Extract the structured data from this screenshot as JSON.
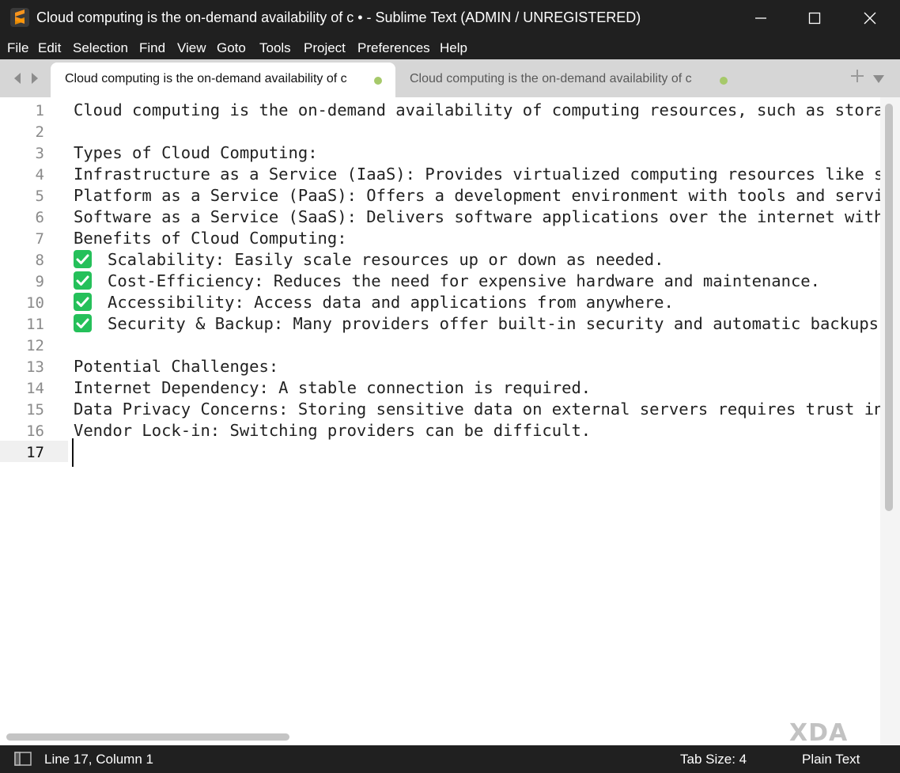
{
  "window": {
    "title": "Cloud computing is the on-demand availability of c • - Sublime Text (ADMIN / UNREGISTERED)",
    "app_icon": "sublime-text-logo",
    "controls": [
      "minimize-icon",
      "maximize-icon",
      "close-icon"
    ]
  },
  "menu": [
    "File",
    "Edit",
    "Selection",
    "Find",
    "View",
    "Goto",
    "Tools",
    "Project",
    "Preferences",
    "Help"
  ],
  "tabs": [
    {
      "label": "Cloud computing is the on-demand availability of c",
      "active": true,
      "unsaved": true
    },
    {
      "label": "Cloud computing is the on-demand availability of c",
      "active": false,
      "unsaved": true
    }
  ],
  "editor": {
    "lines": [
      {
        "number": "1",
        "text": "Cloud computing is the on-demand availability of computing resources, such as stora",
        "check": false
      },
      {
        "number": "2",
        "text": "",
        "check": false
      },
      {
        "number": "3",
        "text": "Types of Cloud Computing:",
        "check": false
      },
      {
        "number": "4",
        "text": "Infrastructure as a Service (IaaS): Provides virtualized computing resources like s",
        "check": false
      },
      {
        "number": "5",
        "text": "Platform as a Service (PaaS): Offers a development environment with tools and servi",
        "check": false
      },
      {
        "number": "6",
        "text": "Software as a Service (SaaS): Delivers software applications over the internet with",
        "check": false
      },
      {
        "number": "7",
        "text": "Benefits of Cloud Computing:",
        "check": false
      },
      {
        "number": "8",
        "text": "Scalability: Easily scale resources up or down as needed.",
        "check": true
      },
      {
        "number": "9",
        "text": "Cost-Efficiency: Reduces the need for expensive hardware and maintenance.",
        "check": true
      },
      {
        "number": "10",
        "text": "Accessibility: Access data and applications from anywhere.",
        "check": true
      },
      {
        "number": "11",
        "text": "Security & Backup: Many providers offer built-in security and automatic backups",
        "check": true
      },
      {
        "number": "12",
        "text": "",
        "check": false
      },
      {
        "number": "13",
        "text": "Potential Challenges:",
        "check": false
      },
      {
        "number": "14",
        "text": "Internet Dependency: A stable connection is required.",
        "check": false
      },
      {
        "number": "15",
        "text": "Data Privacy Concerns: Storing sensitive data on external servers requires trust in",
        "check": false
      },
      {
        "number": "16",
        "text": "Vendor Lock-in: Switching providers can be difficult.",
        "check": false
      },
      {
        "number": "17",
        "text": "",
        "check": false
      }
    ],
    "current_line": "17"
  },
  "watermark": "XDA",
  "status": {
    "position": "Line 17, Column 1",
    "tab_size": "Tab Size: 4",
    "syntax": "Plain Text"
  },
  "colors": {
    "chrome": "#202020",
    "tab_strip": "#d6d6d6",
    "unsaved_dot": "#a6c96a",
    "check_mark": "#25c05a"
  }
}
